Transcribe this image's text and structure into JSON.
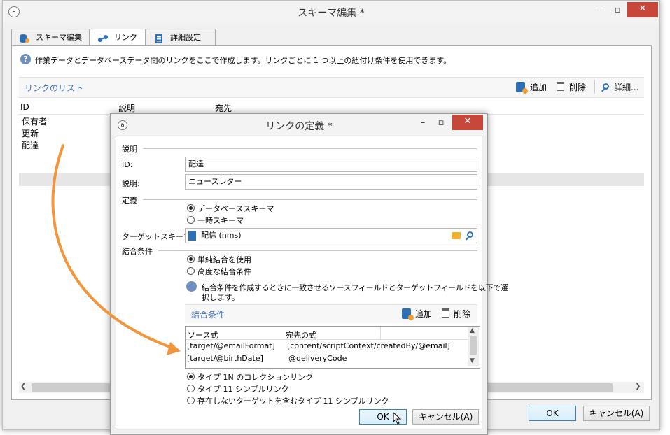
{
  "main": {
    "title": "スキーマ編集 *",
    "tabs": [
      {
        "label": "スキーマ編集"
      },
      {
        "label": "リンク"
      },
      {
        "label": "詳細設定"
      }
    ],
    "info_text": "作業データとデータベースデータ間のリンクをここで作成します。リンクごとに 1 つ以上の紐付け条件を使用できます。",
    "list_title": "リンクのリスト",
    "toolbar": {
      "add": "追加",
      "delete": "削除",
      "detail": "詳細..."
    },
    "columns": [
      "ID",
      "説明",
      "宛先"
    ],
    "rows": [
      "保有者",
      "更新",
      "配達"
    ],
    "ok": "OK",
    "cancel": "キャンセル(A)"
  },
  "dialog": {
    "title": "リンクの定義 *",
    "section_desc": "説明",
    "id_label": "ID:",
    "id_value": "配達",
    "desc_label": "説明:",
    "desc_value": "ニュースレター",
    "section_def": "定義",
    "radio_db": "データベーススキーマ",
    "radio_temp": "一時スキーマ",
    "target_label": "ターゲットスキーマ:",
    "target_value": "配信 (nms)",
    "section_join": "結合条件",
    "radio_simple": "単純結合を使用",
    "radio_advanced": "高度な結合条件",
    "help_text_line1": "結合条件を作成するときに一致させるソースフィールドとターゲットフィールドを以下で選",
    "help_text_line2": "択します。",
    "join_title": "結合条件",
    "join_add": "追加",
    "join_delete": "削除",
    "join_columns": [
      "ソース式",
      "宛先の式"
    ],
    "join_rows": [
      [
        "[target/@emailFormat]",
        "[content/scriptContext/createdBy/@email]"
      ],
      [
        "[target/@birthDate]",
        "@deliveryCode"
      ]
    ],
    "type_1n": "タイプ 1N のコレクションリンク",
    "type_11": "タイプ 11 シンプルリンク",
    "type_11_missing": "存在しないターゲットを含むタイプ 11 シンプルリンク",
    "ok": "OK",
    "cancel": "キャンセル(A)"
  },
  "colors": {
    "arrow": "#f0963c",
    "close": "#c7483a",
    "link": "#3d6fb0"
  }
}
